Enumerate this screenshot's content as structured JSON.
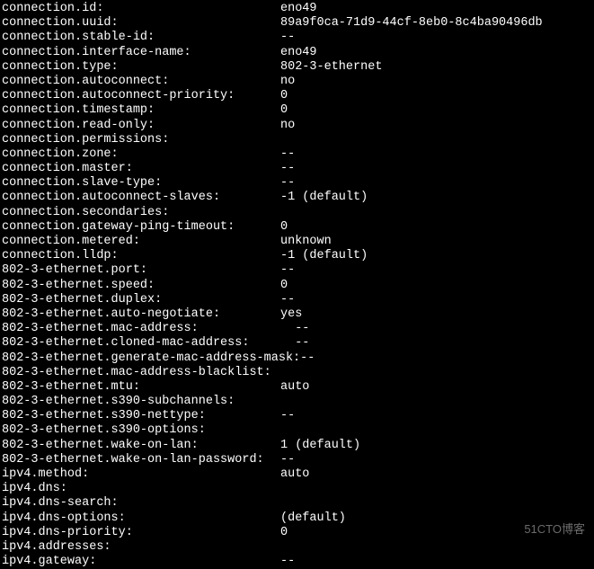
{
  "rows": [
    {
      "key": "connection.id:",
      "val": "eno49"
    },
    {
      "key": "connection.uuid:",
      "val": "89a9f0ca-71d9-44cf-8eb0-8c4ba90496db"
    },
    {
      "key": "connection.stable-id:",
      "val": "--"
    },
    {
      "key": "connection.interface-name:",
      "val": "eno49"
    },
    {
      "key": "connection.type:",
      "val": "802-3-ethernet"
    },
    {
      "key": "connection.autoconnect:",
      "val": "no"
    },
    {
      "key": "connection.autoconnect-priority:",
      "val": "0"
    },
    {
      "key": "connection.timestamp:",
      "val": "0"
    },
    {
      "key": "connection.read-only:",
      "val": "no"
    },
    {
      "key": "connection.permissions:",
      "val": ""
    },
    {
      "key": "connection.zone:",
      "val": "--"
    },
    {
      "key": "connection.master:",
      "val": "--"
    },
    {
      "key": "connection.slave-type:",
      "val": "--"
    },
    {
      "key": "connection.autoconnect-slaves:",
      "val": "-1 (default)"
    },
    {
      "key": "connection.secondaries:",
      "val": ""
    },
    {
      "key": "connection.gateway-ping-timeout:",
      "val": "0"
    },
    {
      "key": "connection.metered:",
      "val": "unknown"
    },
    {
      "key": "connection.lldp:",
      "val": "-1 (default)"
    },
    {
      "key": "802-3-ethernet.port:",
      "val": "--"
    },
    {
      "key": "802-3-ethernet.speed:",
      "val": "0"
    },
    {
      "key": "802-3-ethernet.duplex:",
      "val": "--"
    },
    {
      "key": "802-3-ethernet.auto-negotiate:",
      "val": "yes"
    },
    {
      "key": "802-3-ethernet.mac-address:",
      "val": "  --"
    },
    {
      "key": "802-3-ethernet.cloned-mac-address:",
      "val": "  --"
    },
    {
      "key": "802-3-ethernet.generate-mac-address-mask:--",
      "val": ""
    },
    {
      "key": "802-3-ethernet.mac-address-blacklist:",
      "val": ""
    },
    {
      "key": "802-3-ethernet.mtu:",
      "val": "auto"
    },
    {
      "key": "802-3-ethernet.s390-subchannels:",
      "val": ""
    },
    {
      "key": "802-3-ethernet.s390-nettype:",
      "val": "--"
    },
    {
      "key": "802-3-ethernet.s390-options:",
      "val": ""
    },
    {
      "key": "802-3-ethernet.wake-on-lan:",
      "val": "1 (default)"
    },
    {
      "key": "802-3-ethernet.wake-on-lan-password:",
      "val": "--"
    },
    {
      "key": "ipv4.method:",
      "val": "auto"
    },
    {
      "key": "ipv4.dns:",
      "val": ""
    },
    {
      "key": "ipv4.dns-search:",
      "val": ""
    },
    {
      "key": "ipv4.dns-options:",
      "val": "(default)"
    },
    {
      "key": "ipv4.dns-priority:",
      "val": "0"
    },
    {
      "key": "ipv4.addresses:",
      "val": ""
    },
    {
      "key": "ipv4.gateway:",
      "val": "--"
    }
  ],
  "watermark": "51CTO博客"
}
